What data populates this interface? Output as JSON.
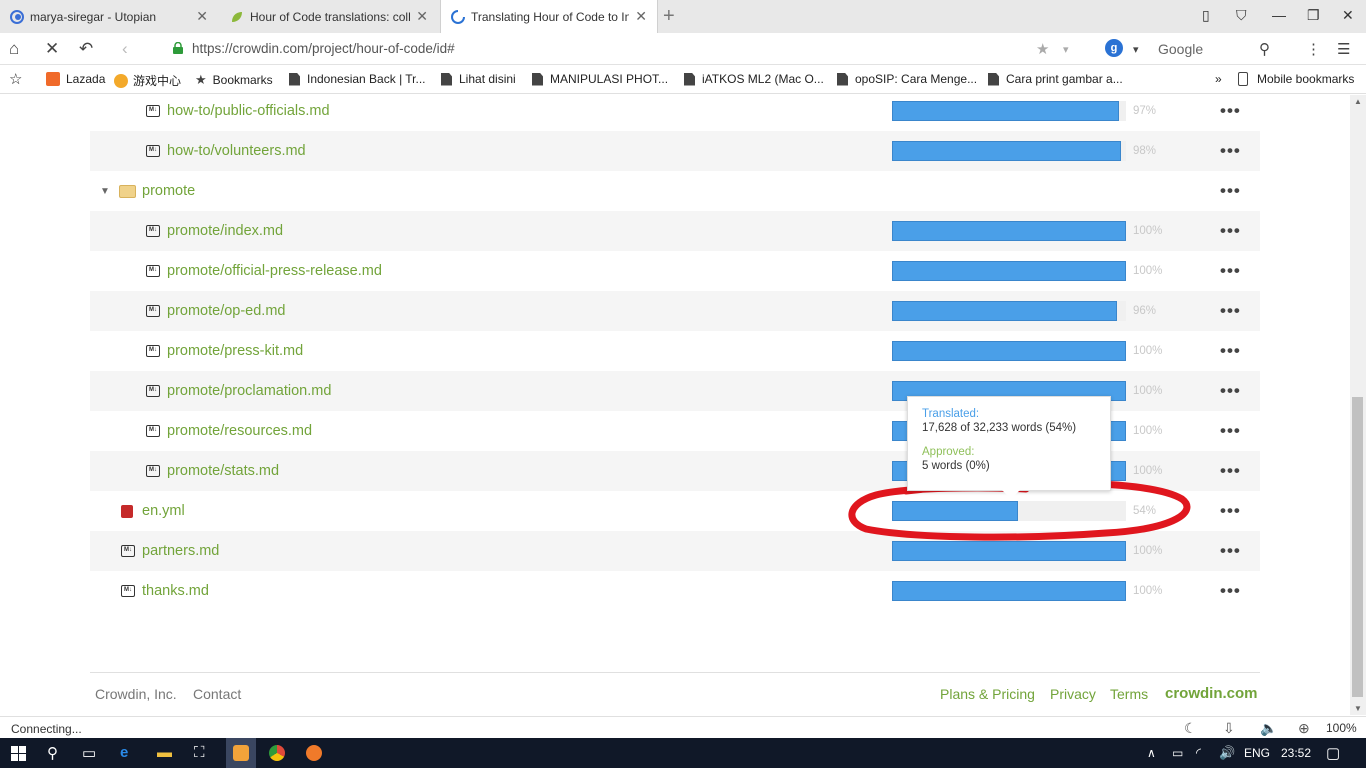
{
  "tabs": [
    {
      "title": "marya-siregar - Utopian",
      "icon": "utopian-icon"
    },
    {
      "title": "Hour of Code translations: coll",
      "icon": "leaf-icon"
    },
    {
      "title": "Translating Hour of Code to In",
      "icon": "loading-spinner-icon"
    }
  ],
  "address": {
    "url": "https://crowdin.com/project/hour-of-code/id#",
    "search_engine_letter": "g",
    "search_label": "Google"
  },
  "bookmarks": [
    "Lazada",
    "游戏中心",
    "Bookmarks",
    "Indonesian Back | Tr...",
    "Lihat disini",
    "MANIPULASI PHOT...",
    "iATKOS ML2 (Mac O...",
    "opoSIP: Cara Menge...",
    "Cara print gambar a..."
  ],
  "bookmarks_more": "»",
  "mobile_bookmarks": "Mobile bookmarks",
  "files": [
    {
      "name": "how-to/public-officials.md",
      "progress": 0.97,
      "pct": "97%"
    },
    {
      "name": "how-to/volunteers.md",
      "progress": 0.98,
      "pct": "98%"
    },
    {
      "name": "promote",
      "folder": true
    },
    {
      "name": "promote/index.md",
      "progress": 1.0,
      "pct": "100%"
    },
    {
      "name": "promote/official-press-release.md",
      "progress": 1.0,
      "pct": "100%"
    },
    {
      "name": "promote/op-ed.md",
      "progress": 0.96,
      "pct": "96%"
    },
    {
      "name": "promote/press-kit.md",
      "progress": 1.0,
      "pct": "100%"
    },
    {
      "name": "promote/proclamation.md",
      "progress": 1.0,
      "pct": "100%"
    },
    {
      "name": "promote/resources.md",
      "progress": 1.0,
      "pct": "100%"
    },
    {
      "name": "promote/stats.md",
      "progress": 1.0,
      "pct": "100%"
    },
    {
      "name": "en.yml",
      "progress": 0.54,
      "pct": "54%"
    },
    {
      "name": "partners.md",
      "progress": 1.0,
      "pct": "100%"
    },
    {
      "name": "thanks.md",
      "progress": 1.0,
      "pct": "100%"
    }
  ],
  "md_badge": "M↓",
  "more_label": "•••",
  "tooltip": {
    "translated_label": "Translated:",
    "translated_value": "17,628 of 32,233 words (54%)",
    "approved_label": "Approved:",
    "approved_value": "5 words (0%)"
  },
  "footer": {
    "company": "Crowdin, Inc.",
    "contact": "Contact",
    "plans": "Plans & Pricing",
    "privacy": "Privacy",
    "terms": "Terms",
    "brand": "crowdin.com"
  },
  "status": {
    "text": "Connecting...",
    "zoom": "100%"
  },
  "taskbar": {
    "lang": "ENG",
    "time": "23:52"
  },
  "colors": {
    "link": "#72a43a",
    "bar": "#4a9fe8",
    "annotation": "#e0161e"
  }
}
